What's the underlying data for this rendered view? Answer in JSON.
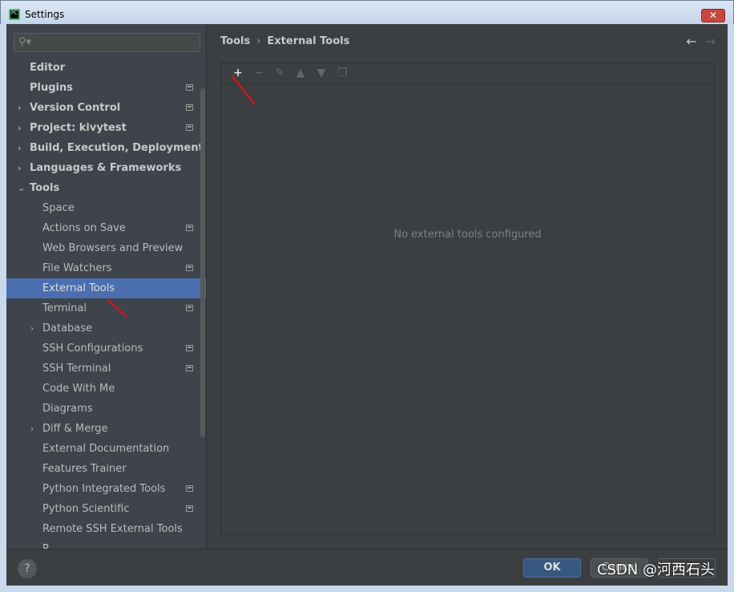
{
  "window": {
    "title": "Settings",
    "close": "✕"
  },
  "search": {
    "placeholder": "",
    "icon": "search-icon"
  },
  "sidebar": {
    "items": [
      {
        "label": "Editor",
        "level": 0,
        "bold": true,
        "arrow": "",
        "flag": false
      },
      {
        "label": "Plugins",
        "level": 0,
        "bold": true,
        "arrow": "",
        "flag": true
      },
      {
        "label": "Version Control",
        "level": 0,
        "bold": true,
        "arrow": "›",
        "flag": true
      },
      {
        "label": "Project: kivytest",
        "level": 0,
        "bold": true,
        "arrow": "›",
        "flag": true
      },
      {
        "label": "Build, Execution, Deployment",
        "level": 0,
        "bold": true,
        "arrow": "›",
        "flag": false
      },
      {
        "label": "Languages & Frameworks",
        "level": 0,
        "bold": true,
        "arrow": "›",
        "flag": false
      },
      {
        "label": "Tools",
        "level": 0,
        "bold": true,
        "arrow": "⌄",
        "flag": false
      },
      {
        "label": "Space",
        "level": 1,
        "arrow": "",
        "flag": false
      },
      {
        "label": "Actions on Save",
        "level": 1,
        "arrow": "",
        "flag": true
      },
      {
        "label": "Web Browsers and Preview",
        "level": 1,
        "arrow": "",
        "flag": false
      },
      {
        "label": "File Watchers",
        "level": 1,
        "arrow": "",
        "flag": true
      },
      {
        "label": "External Tools",
        "level": 1,
        "arrow": "",
        "flag": false,
        "selected": true
      },
      {
        "label": "Terminal",
        "level": 1,
        "arrow": "",
        "flag": true
      },
      {
        "label": "Database",
        "level": 1,
        "arrow": "›",
        "flag": false
      },
      {
        "label": "SSH Configurations",
        "level": 1,
        "arrow": "",
        "flag": true
      },
      {
        "label": "SSH Terminal",
        "level": 1,
        "arrow": "",
        "flag": true
      },
      {
        "label": "Code With Me",
        "level": 1,
        "arrow": "",
        "flag": false
      },
      {
        "label": "Diagrams",
        "level": 1,
        "arrow": "",
        "flag": false
      },
      {
        "label": "Diff & Merge",
        "level": 1,
        "arrow": "›",
        "flag": false
      },
      {
        "label": "External Documentation",
        "level": 1,
        "arrow": "",
        "flag": false
      },
      {
        "label": "Features Trainer",
        "level": 1,
        "arrow": "",
        "flag": false
      },
      {
        "label": "Python Integrated Tools",
        "level": 1,
        "arrow": "",
        "flag": true
      },
      {
        "label": "Python Scientific",
        "level": 1,
        "arrow": "",
        "flag": true
      },
      {
        "label": "Remote SSH External Tools",
        "level": 1,
        "arrow": "",
        "flag": false
      },
      {
        "label": "R...",
        "level": 1,
        "arrow": "",
        "flag": false
      }
    ]
  },
  "breadcrumb": {
    "parent": "Tools",
    "separator": "›",
    "current": "External Tools"
  },
  "nav": {
    "back": "←",
    "forward": "→"
  },
  "toolbar": {
    "add": "+",
    "remove": "−",
    "edit": "✎",
    "up": "▲",
    "down": "▼",
    "copy": "❐"
  },
  "main": {
    "empty_text": "No external tools configured"
  },
  "footer": {
    "help": "?",
    "ok": "OK",
    "cancel": "Cancel",
    "apply": "Apply"
  },
  "watermark": "CSDN @河西石头",
  "colors": {
    "selection": "#4b6eaf",
    "ok_button": "#365880",
    "annotation_arrow": "#e81010"
  }
}
